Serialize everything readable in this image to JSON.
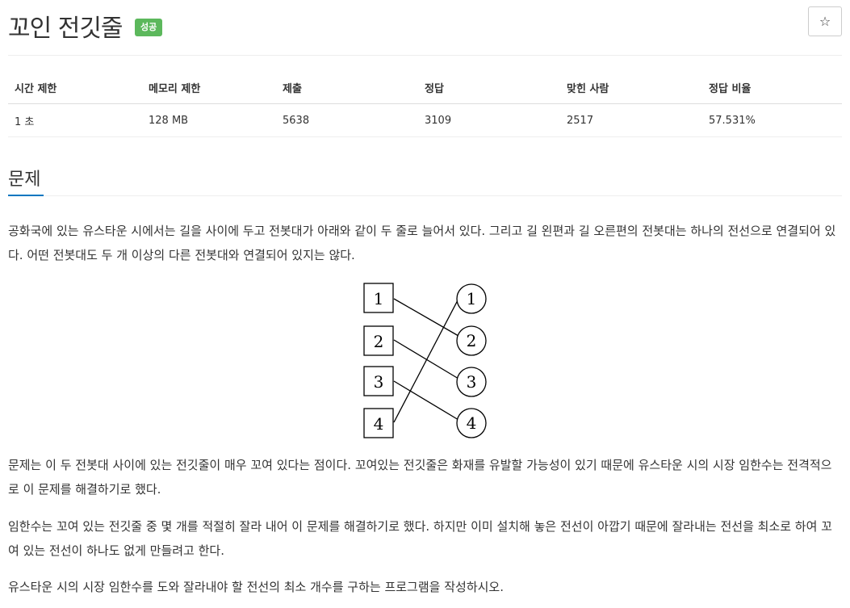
{
  "header": {
    "title": "꼬인 전깃줄",
    "badge": "성공",
    "star_icon": "☆"
  },
  "stats": {
    "headers": [
      "시간 제한",
      "메모리 제한",
      "제출",
      "정답",
      "맞힌 사람",
      "정답 비율"
    ],
    "values": [
      "1 초",
      "128 MB",
      "5638",
      "3109",
      "2517",
      "57.531%"
    ]
  },
  "problem": {
    "section_title": "문제",
    "paragraph1": "공화국에 있는 유스타운 시에서는 길을 사이에 두고 전봇대가 아래와 같이 두 줄로 늘어서 있다. 그리고 길 왼편과 길 오른편의 전봇대는 하나의 전선으로 연결되어 있다. 어떤 전봇대도 두 개 이상의 다른 전봇대와 연결되어 있지는 않다.",
    "figure": {
      "left_labels": [
        "1",
        "2",
        "3",
        "4"
      ],
      "right_labels": [
        "1",
        "2",
        "3",
        "4"
      ]
    },
    "paragraph2": "문제는 이 두 전봇대 사이에 있는 전깃줄이 매우 꼬여 있다는 점이다. 꼬여있는 전깃줄은 화재를 유발할 가능성이 있기 때문에 유스타운 시의 시장 임한수는 전격적으로 이 문제를 해결하기로 했다.",
    "paragraph3": "임한수는 꼬여 있는 전깃줄 중 몇 개를 적절히 잘라 내어 이 문제를 해결하기로 했다. 하지만 이미 설치해 놓은 전선이 아깝기 때문에 잘라내는 전선을 최소로 하여 꼬여 있는 전선이 하나도 없게 만들려고 한다.",
    "paragraph4": "유스타운 시의 시장 임한수를 도와 잘라내야 할 전선의 최소 개수를 구하는 프로그램을 작성하시오."
  }
}
